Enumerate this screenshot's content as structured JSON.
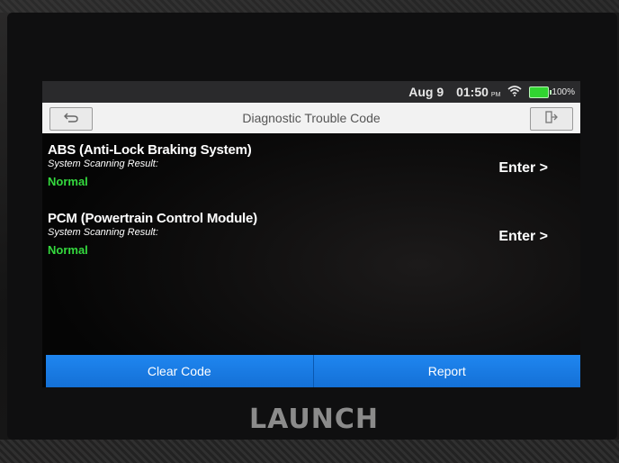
{
  "status_bar": {
    "date": "Aug 9",
    "time": "01:50",
    "ampm": "PM",
    "battery_percent": "100%",
    "battery_level": 1.0
  },
  "header": {
    "title": "Diagnostic Trouble Code"
  },
  "systems": [
    {
      "name": "ABS (Anti-Lock Braking System)",
      "scan_label": "System Scanning Result:",
      "status": "Normal",
      "enter_label": "Enter >"
    },
    {
      "name": "PCM (Powertrain Control Module)",
      "scan_label": "System Scanning Result:",
      "status": "Normal",
      "enter_label": "Enter >"
    }
  ],
  "actions": {
    "clear_label": "Clear Code",
    "report_label": "Report"
  },
  "device": {
    "brand": "LAUNCH"
  },
  "colors": {
    "status_normal": "#34d93e",
    "action_blue": "#1a7fe8",
    "battery_green": "#31d431"
  },
  "icons": {
    "back": "back-arrow-icon",
    "exit": "exit-icon",
    "wifi": "wifi-icon",
    "battery": "battery-icon"
  }
}
